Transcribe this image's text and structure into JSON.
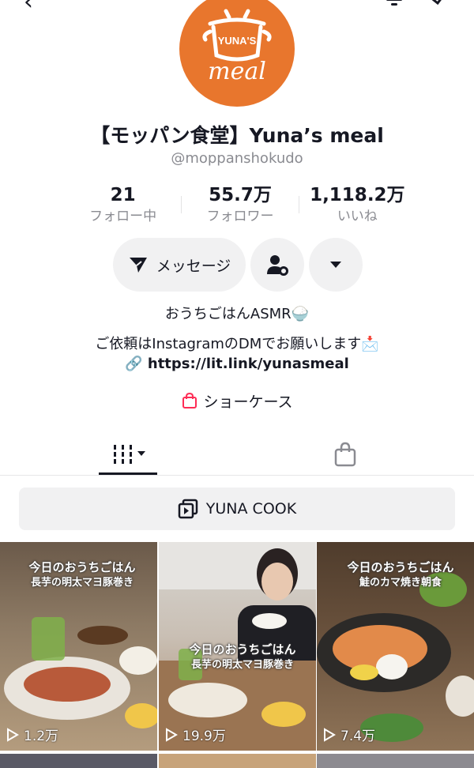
{
  "profile": {
    "logo_text_top": "YUNA'S",
    "logo_text_bottom": "meal",
    "name": "【モッパン食堂】Yuna’s meal",
    "handle": "@moppanshokudo"
  },
  "stats": [
    {
      "value": "21",
      "label": "フォロー中"
    },
    {
      "value": "55.7万",
      "label": "フォロワー"
    },
    {
      "value": "1,118.2万",
      "label": "いいね"
    }
  ],
  "actions": {
    "message_label": "メッセージ"
  },
  "bio": {
    "line1": "おうちごはんASMR🍚",
    "line2": "ご依頼はInstagramのDMでお願いします📩",
    "link": "https://lit.link/yunasmeal"
  },
  "showcase_label": "ショーケース",
  "playlist_label": "YUNA COOK",
  "videos": [
    {
      "caption_line1": "今日のおうちごはん",
      "caption_line2": "長芋の明太マヨ豚巻き",
      "views": "1.2万"
    },
    {
      "caption_line1": "今日のおうちごはん",
      "caption_line2": "長芋の明太マヨ豚巻き",
      "views": "19.9万"
    },
    {
      "caption_line1": "今日のおうちごはん",
      "caption_line2": "鮭のカマ焼き朝食",
      "views": "7.4万"
    }
  ],
  "colors": {
    "brand_orange": "#e8762d",
    "text_primary": "#161823",
    "text_secondary": "#8a8b91",
    "button_bg": "#f1f1f2",
    "showcase_icon": "#fe2c55"
  }
}
